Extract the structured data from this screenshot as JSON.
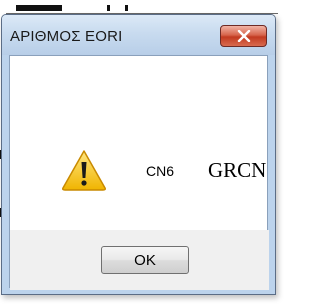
{
  "dialog": {
    "title": "ΑΡΙΘΜΟΣ EORI",
    "code_text": "CN6",
    "value_text": "GRCN",
    "ok_label": "OK",
    "icon": "warning-icon",
    "close_icon": "close-icon"
  },
  "colors": {
    "titlebar": "#c8dbef",
    "close_button": "#c94a31",
    "client_background": "#ffffff",
    "button_area": "#f0f0f0",
    "warning_yellow": "#f3c21c"
  }
}
